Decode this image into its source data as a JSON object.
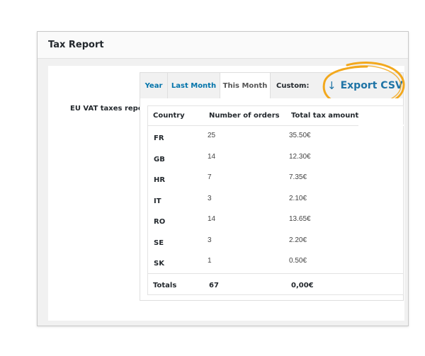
{
  "window": {
    "title": "Tax Report"
  },
  "report": {
    "label": "EU VAT taxes report"
  },
  "tabs": [
    {
      "label": "Year",
      "active": false
    },
    {
      "label": "Last Month",
      "active": false
    },
    {
      "label": "This Month",
      "active": true
    },
    {
      "label": "Custom:",
      "active": false
    }
  ],
  "export": {
    "label": "Export CSV",
    "icon": "arrow-down-icon",
    "color": "#1f74a6",
    "highlight_color": "#f2a81d"
  },
  "table": {
    "headers": [
      "Country",
      "Number of orders",
      "Total tax amount"
    ],
    "rows": [
      {
        "country": "FR",
        "orders": "25",
        "tax": "35.50€"
      },
      {
        "country": "GB",
        "orders": "14",
        "tax": "12.30€"
      },
      {
        "country": "HR",
        "orders": "7",
        "tax": "7.35€"
      },
      {
        "country": "IT",
        "orders": "3",
        "tax": "2.10€"
      },
      {
        "country": "RO",
        "orders": "14",
        "tax": "13.65€"
      },
      {
        "country": "SE",
        "orders": "3",
        "tax": "2.20€"
      },
      {
        "country": "SK",
        "orders": "1",
        "tax": "0.50€"
      }
    ],
    "totals": {
      "label": "Totals",
      "orders": "67",
      "tax": "0,00€"
    }
  }
}
